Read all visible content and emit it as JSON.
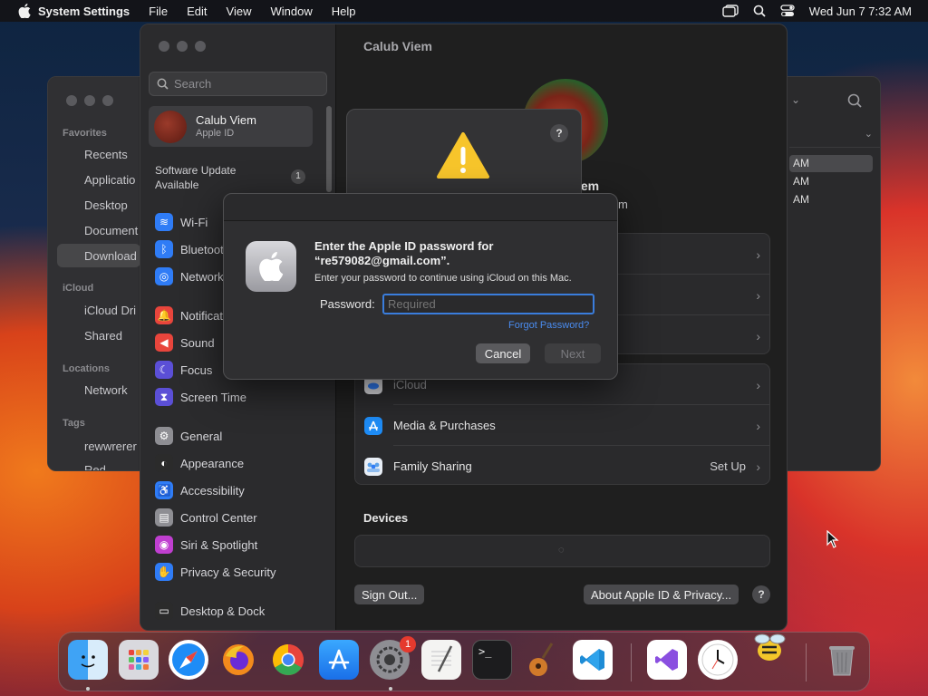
{
  "menubar": {
    "app_name": "System Settings",
    "menus": [
      "File",
      "Edit",
      "View",
      "Window",
      "Help"
    ],
    "clock": "Wed Jun 7  7:32 AM"
  },
  "finder": {
    "sections": {
      "favorites": "Favorites",
      "icloud": "iCloud",
      "locations": "Locations",
      "tags": "Tags"
    },
    "favorites": [
      "Recents",
      "Applicatio",
      "Desktop",
      "Document",
      "Download"
    ],
    "icloud": [
      "iCloud Dri",
      "Shared"
    ],
    "locations": [
      "Network"
    ],
    "tags": [
      "rewwrerer",
      "Red"
    ],
    "list_times": [
      "AM",
      "AM",
      "AM"
    ]
  },
  "settings": {
    "search_placeholder": "Search",
    "account": {
      "name": "Calub Viem",
      "subtitle": "Apple ID"
    },
    "software_update": "Software Update Available",
    "software_update_badge": "1",
    "sidebar_items": [
      {
        "label": "Wi-Fi",
        "icon": "wifi-icon",
        "color": "#2f7cf6"
      },
      {
        "label": "Bluetooth",
        "icon": "bluetooth-icon",
        "color": "#2f7cf6"
      },
      {
        "label": "Network",
        "icon": "globe-icon",
        "color": "#2f7cf6"
      },
      {
        "label": "Notifications",
        "icon": "bell-icon",
        "color": "#e8453c"
      },
      {
        "label": "Sound",
        "icon": "speaker-icon",
        "color": "#e8453c"
      },
      {
        "label": "Focus",
        "icon": "moon-icon",
        "color": "#5b4fd6"
      },
      {
        "label": "Screen Time",
        "icon": "hourglass-icon",
        "color": "#5b4fd6"
      },
      {
        "label": "General",
        "icon": "gear-icon",
        "color": "#8e8e93"
      },
      {
        "label": "Appearance",
        "icon": "appearance-icon",
        "color": "#2b2b2b"
      },
      {
        "label": "Accessibility",
        "icon": "accessibility-icon",
        "color": "#2f7cf6"
      },
      {
        "label": "Control Center",
        "icon": "control-center-icon",
        "color": "#8e8e93"
      },
      {
        "label": "Siri & Spotlight",
        "icon": "siri-icon",
        "color": "#c03fd0"
      },
      {
        "label": "Privacy & Security",
        "icon": "hand-icon",
        "color": "#2f7cf6"
      },
      {
        "label": "Desktop & Dock",
        "icon": "dock-icon",
        "color": "#2b2b2b"
      }
    ],
    "main_title": "Calub Viem",
    "profile_name_partial": "iem",
    "profile_email_partial": "m",
    "rows": [
      {
        "label": "iCloud",
        "value": "",
        "icon": "icloud-icon"
      },
      {
        "label": "Media & Purchases",
        "value": "",
        "icon": "app-store-icon"
      },
      {
        "label": "Family Sharing",
        "value": "Set Up",
        "icon": "family-icon"
      }
    ],
    "devices_heading": "Devices",
    "sign_out": "Sign Out...",
    "about": "About Apple ID & Privacy...",
    "help": "?"
  },
  "alert": {
    "help": "?"
  },
  "dialog": {
    "title": "Enter the Apple ID password for “re579082@gmail.com”.",
    "subtitle": "Enter your password to continue using iCloud on this Mac.",
    "password_label": "Password:",
    "password_placeholder": "Required",
    "forgot": "Forgot Password?",
    "cancel": "Cancel",
    "next": "Next"
  },
  "dock": {
    "apps": [
      "Finder",
      "Launchpad",
      "Safari",
      "Firefox",
      "Chrome",
      "App Store",
      "System Settings",
      "TextEdit",
      "Terminal",
      "GarageBand",
      "VS Code",
      "Visual Studio",
      "Clock",
      "Cyberduck",
      "Trash"
    ],
    "system_settings_badge": "1"
  }
}
